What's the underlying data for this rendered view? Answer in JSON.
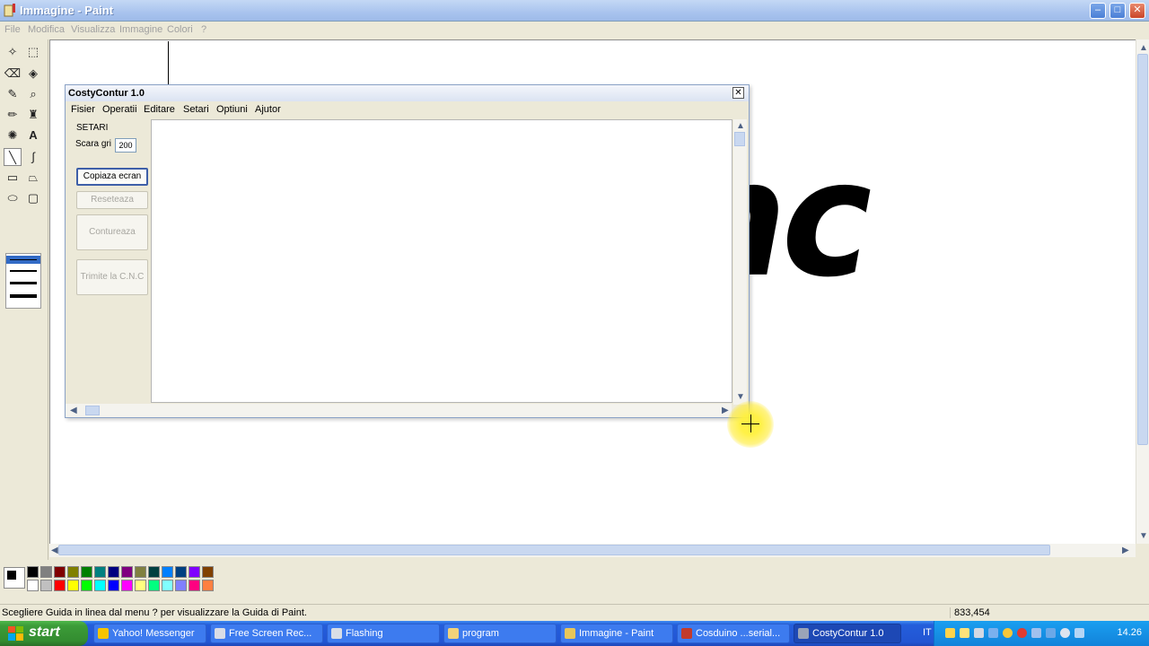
{
  "window": {
    "title": "Immagine - Paint",
    "min_label": "–",
    "max_label": "□",
    "close_label": "✕"
  },
  "menu": {
    "file": "File",
    "modifica": "Modifica",
    "visualizza": "Visualizza",
    "immagine": "Immagine",
    "colori": "Colori",
    "help": "?"
  },
  "canvas": {
    "drawing_text": "costycnc"
  },
  "dialog": {
    "title": "CostyContur 1.0",
    "close_label": "✕",
    "menu": [
      "Fisier",
      "Operatii",
      "Editare",
      "Setari",
      "Optiuni",
      "Ajutor"
    ],
    "setari_label": "SETARI",
    "scara_label": "Scara gri",
    "scara_value": "200",
    "buttons": {
      "copiaza": "Copiaza ecran",
      "reseteaza": "Reseteaza",
      "contureaza": "Contureaza",
      "trimite": "Trimite la C.N.C"
    }
  },
  "palette": {
    "colors_top": [
      "#000000",
      "#808080",
      "#800000",
      "#808000",
      "#008000",
      "#008080",
      "#000080",
      "#800080",
      "#808040",
      "#004040",
      "#0080ff",
      "#004080",
      "#8000ff",
      "#804000"
    ],
    "colors_bottom": [
      "#ffffff",
      "#c0c0c0",
      "#ff0000",
      "#ffff00",
      "#00ff00",
      "#00ffff",
      "#0000ff",
      "#ff00ff",
      "#ffff80",
      "#00ff80",
      "#80ffff",
      "#8080ff",
      "#ff0080",
      "#ff8040"
    ]
  },
  "statusbar": {
    "help_text": "Scegliere Guida in linea dal menu ? per visualizzare la Guida di Paint.",
    "coords": "833,454"
  },
  "taskbar": {
    "start_label": "start",
    "tasks": [
      {
        "label": "Yahoo! Messenger",
        "icon": "yahoo-messenger-icon",
        "color": "#f5c400"
      },
      {
        "label": "Free Screen Rec...",
        "icon": "screen-recorder-icon",
        "color": "#d9dde6"
      },
      {
        "label": "Flashing",
        "icon": "flashing-icon",
        "color": "#d9dde6"
      },
      {
        "label": "program",
        "icon": "folder-icon",
        "color": "#f2d27a"
      },
      {
        "label": "Immagine - Paint",
        "icon": "paint-icon",
        "color": "#e8c65a"
      },
      {
        "label": "Cosduino ...serial...",
        "icon": "arduino-icon",
        "color": "#c23b2b"
      },
      {
        "label": "CostyContur 1.0",
        "icon": "costycontur-icon",
        "color": "#9aa4b8"
      }
    ],
    "lang": "IT",
    "clock": "14.26"
  }
}
